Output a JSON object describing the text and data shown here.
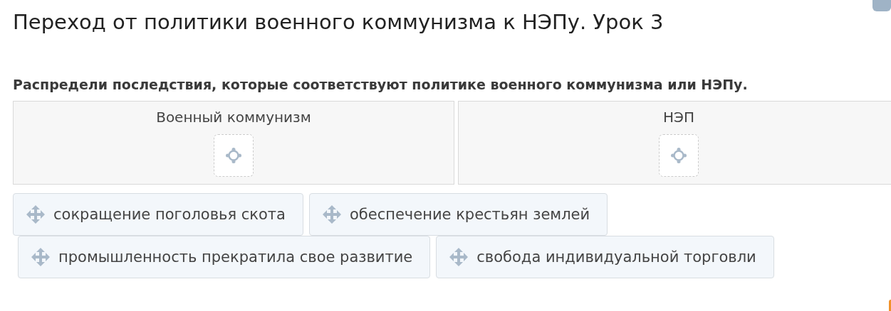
{
  "title": "Переход от политики военного коммунизма к НЭПу. Урок 3",
  "instruction": "Распредели последствия, которые соответствуют политике военного коммунизма или НЭПу.",
  "targets": [
    {
      "label": "Военный коммунизм"
    },
    {
      "label": "НЭП"
    }
  ],
  "items": [
    [
      "сокращение поголовья скота",
      "обеспечение крестьян землей"
    ],
    [
      "промышленность прекратила свое развитие",
      "свобода индивидуальной торговли"
    ]
  ]
}
